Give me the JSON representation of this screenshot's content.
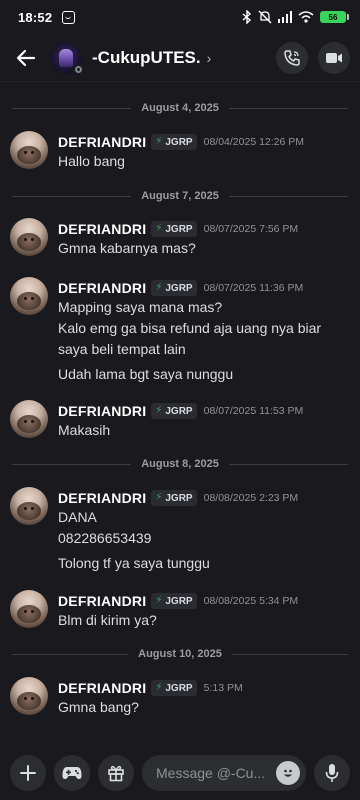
{
  "status_bar": {
    "time": "18:52",
    "battery": "56"
  },
  "header": {
    "channel_name": "-CukupUTES.",
    "chevron": "›"
  },
  "dividers": [
    "August 4, 2025",
    "August 7, 2025",
    "August 8, 2025",
    "August 10, 2025"
  ],
  "messages": [
    {
      "username": "DEFRIANDRI",
      "tag": "JGRP",
      "timestamp": "08/04/2025 12:26 PM",
      "lines": [
        "Hallo bang"
      ]
    },
    {
      "username": "DEFRIANDRI",
      "tag": "JGRP",
      "timestamp": "08/07/2025 7:56 PM",
      "lines": [
        "Gmna kabarnya mas?"
      ]
    },
    {
      "username": "DEFRIANDRI",
      "tag": "JGRP",
      "timestamp": "08/07/2025 11:36 PM",
      "lines": [
        "Mapping saya mana mas?",
        "Kalo emg ga bisa refund aja uang nya biar",
        "saya beli tempat lain",
        "Udah lama bgt saya nunggu"
      ]
    },
    {
      "username": "DEFRIANDRI",
      "tag": "JGRP",
      "timestamp": "08/07/2025 11:53 PM",
      "lines": [
        "Makasih"
      ]
    },
    {
      "username": "DEFRIANDRI",
      "tag": "JGRP",
      "timestamp": "08/08/2025 2:23 PM",
      "lines": [
        "DANA",
        "082286653439",
        "Tolong tf ya saya tunggu"
      ]
    },
    {
      "username": "DEFRIANDRI",
      "tag": "JGRP",
      "timestamp": "08/08/2025 5:34 PM",
      "lines": [
        "Blm di kirim ya?"
      ]
    },
    {
      "username": "DEFRIANDRI",
      "tag": "JGRP",
      "timestamp": "5:13 PM",
      "lines": [
        "Gmna bang?"
      ]
    }
  ],
  "composer": {
    "placeholder": "Message @-Cu..."
  },
  "colors": {
    "background": "#1a1a1e",
    "accent_green": "#3ba55d",
    "battery_green": "#3ad35b",
    "button_bg": "#2b2d31"
  },
  "icons": [
    "back-arrow-icon",
    "voice-call-icon",
    "video-call-icon",
    "plus-icon",
    "gamepad-icon",
    "gift-icon",
    "emoji-icon",
    "microphone-icon"
  ]
}
